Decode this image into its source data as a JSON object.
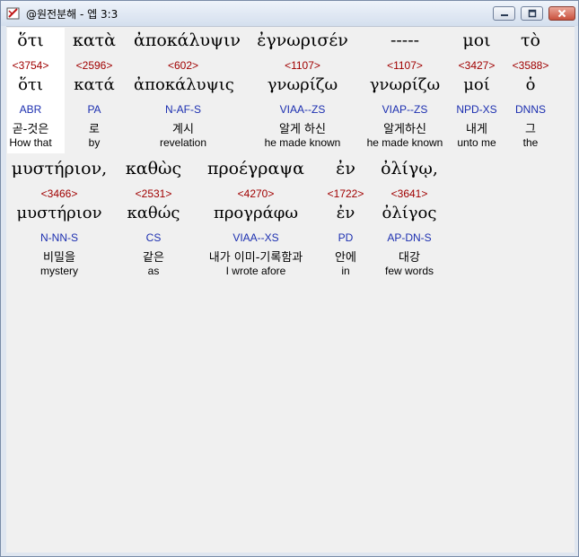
{
  "window": {
    "title": "@원전분해 - 엡 3:3"
  },
  "words": [
    {
      "greek": "ὅτι",
      "strong": "<3754>",
      "lemma": "ὅτι",
      "parse": "ABR",
      "korean": "곧-것은",
      "english": "How that"
    },
    {
      "greek": "κατὰ",
      "strong": "<2596>",
      "lemma": "κατά",
      "parse": "PA",
      "korean": "로",
      "english": "by"
    },
    {
      "greek": "ἀποκάλυψιν",
      "strong": "<602>",
      "lemma": "ἀποκάλυψις",
      "parse": "N-AF-S",
      "korean": "계시",
      "english": "revelation"
    },
    {
      "greek": "ἐγνωρισέν",
      "strong": "<1107>",
      "lemma": "γνωρίζω",
      "parse": "VIAA--ZS",
      "korean": "알게 하신",
      "english": "he made known"
    },
    {
      "greek": "-----",
      "strong": "<1107>",
      "lemma": "γνωρίζω",
      "parse": "VIAP--ZS",
      "korean": "알게하신",
      "english": "he made known"
    },
    {
      "greek": "μοι",
      "strong": "<3427>",
      "lemma": "μοί",
      "parse": "NPD-XS",
      "korean": "내게",
      "english": "unto me"
    },
    {
      "greek": "τὸ",
      "strong": "<3588>",
      "lemma": "ὁ",
      "parse": "DNNS",
      "korean": "그",
      "english": "the"
    },
    {
      "greek": "μυστήριον,",
      "strong": "<3466>",
      "lemma": "μυστήριον",
      "parse": "N-NN-S",
      "korean": "비밀을",
      "english": "mystery"
    },
    {
      "greek": "καθὼς",
      "strong": "<2531>",
      "lemma": "καθώς",
      "parse": "CS",
      "korean": "같은",
      "english": "as"
    },
    {
      "greek": "προέγραψα",
      "strong": "<4270>",
      "lemma": "προγράφω",
      "parse": "VIAA--XS",
      "korean": "내가 이미-기록함과",
      "english": "I wrote afore"
    },
    {
      "greek": "ἐν",
      "strong": "<1722>",
      "lemma": "ἐν",
      "parse": "PD",
      "korean": "안에",
      "english": "in"
    },
    {
      "greek": "ὀλίγῳ,",
      "strong": "<3641>",
      "lemma": "ὀλίγος",
      "parse": "AP-DN-S",
      "korean": "대강",
      "english": "few words"
    }
  ]
}
